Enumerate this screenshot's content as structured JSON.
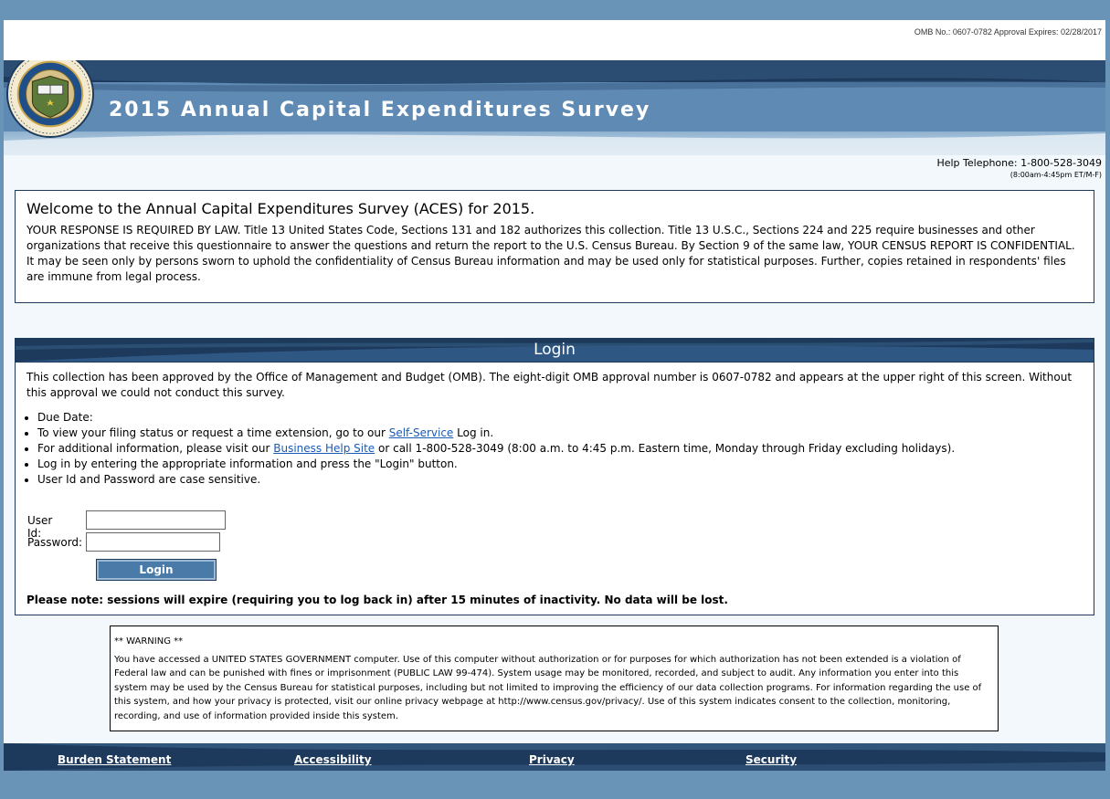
{
  "omb_notice": "OMB No.: 0607-0782 Approval Expires: 02/28/2017",
  "header": {
    "title": "2015 Annual Capital Expenditures Survey",
    "seal_icon": "census-bureau-seal-icon",
    "seal_text_top": "U.S. DEPARTMENT OF COMMERCE",
    "seal_text_bottom": "BUREAU OF THE CENSUS"
  },
  "help": {
    "telephone": "Help Telephone: 1-800-528-3049",
    "hours": "(8:00am-4:45pm ET/M-F)"
  },
  "welcome": {
    "heading": "Welcome to the Annual Capital Expenditures Survey (ACES) for 2015.",
    "body": "YOUR RESPONSE IS REQUIRED BY LAW. Title 13 United States Code, Sections 131 and 182 authorizes this collection. Title 13 U.S.C., Sections 224 and 225 require businesses and other organizations that receive this questionnaire to answer the questions and return the report to the U.S. Census Bureau. By Section 9 of the same law, YOUR CENSUS REPORT IS CONFIDENTIAL. It may be seen only by persons sworn to uphold the confidentiality of Census Bureau information and may be used only for statistical purposes. Further, copies retained in respondents' files are immune from legal process."
  },
  "login": {
    "title": "Login",
    "intro": "This collection has been approved by the Office of Management and Budget (OMB). The eight-digit OMB approval number is 0607-0782 and appears at the upper right of this screen. Without this approval we could not conduct this survey.",
    "bullets": {
      "due_date": "Due Date:",
      "status_prefix": "To view your filing status or request a time extension, go to our ",
      "self_service_link": "Self-Service",
      "status_suffix": " Log in.",
      "info_prefix": "For additional information, please visit our ",
      "help_site_link": "Business Help Site",
      "info_suffix": " or call 1-800-528-3049 (8:00 a.m. to 4:45 p.m. Eastern time, Monday through Friday excluding holidays).",
      "instructions": "Log in by entering the appropriate information and press the \"Login\" button.",
      "case_sensitive": "User Id and Password are case sensitive."
    },
    "userid_label": "User Id:",
    "userid_value": "",
    "password_label": "Password:",
    "password_value": "",
    "button_label": "Login",
    "session_note": "Please note: sessions will expire (requiring you to log back in) after 15 minutes of inactivity. No data will be lost."
  },
  "warning": {
    "title": "** WARNING **",
    "body": "You have accessed a UNITED STATES GOVERNMENT computer. Use of this computer without authorization or for purposes for which authorization has not been extended is a violation of Federal law and can be punished with fines or imprisonment (PUBLIC LAW 99-474). System usage may be monitored, recorded, and subject to audit. Any information you enter into this system may be used by the Census Bureau for statistical purposes, including but not limited to improving the efficiency of our data collection programs. For information regarding the use of this system, and how your privacy is protected, visit our online privacy webpage at http://www.census.gov/privacy/. Use of this system indicates consent to the collection, monitoring, recording, and use of information provided inside this system."
  },
  "footer": {
    "links": [
      "Burden Statement",
      "Accessibility",
      "Privacy",
      "Security"
    ]
  },
  "colors": {
    "navy": "#1d3a5c",
    "header_blue": "#5f8ab3",
    "page_bg": "#6a93b8",
    "link": "#1a5bb5"
  }
}
